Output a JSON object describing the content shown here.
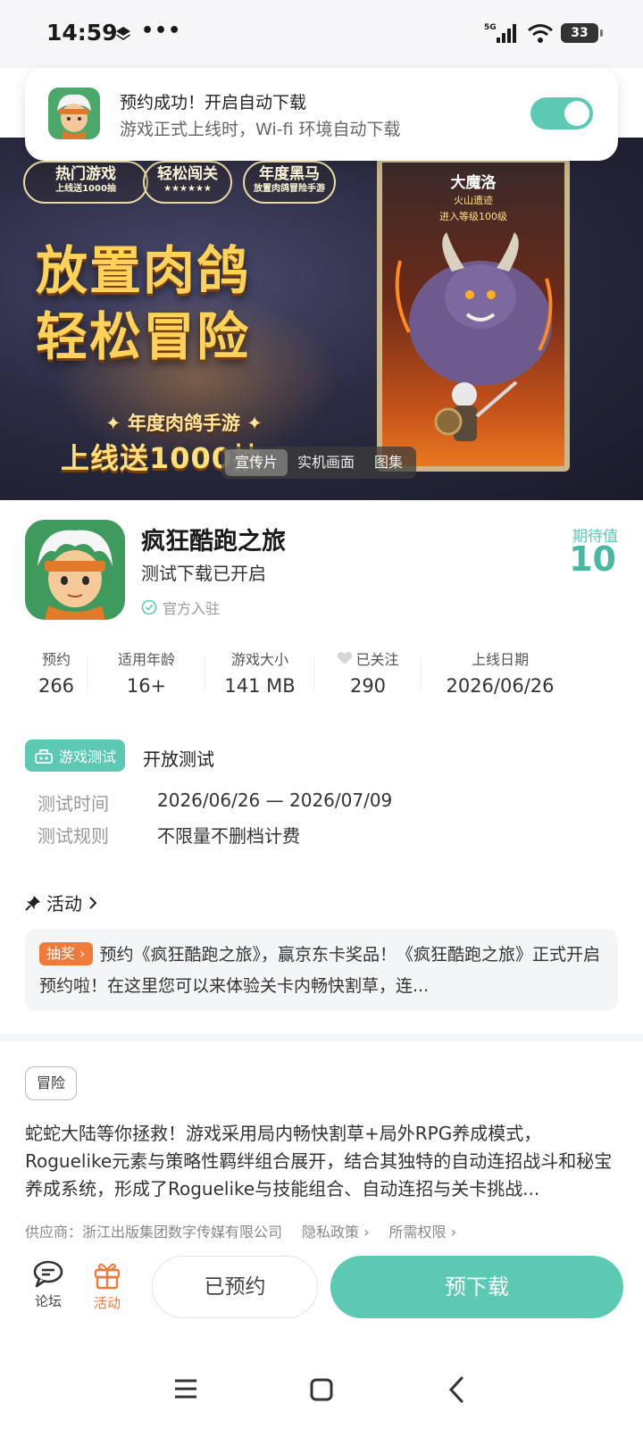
{
  "status_bar": {
    "time": "14:59",
    "dots": "•••",
    "network": "5G",
    "battery": "33"
  },
  "toast": {
    "title": "预约成功！开启自动下载",
    "subtitle": "游戏正式上线时，Wi-fi 环境自动下载",
    "auto_download_enabled": true
  },
  "banner": {
    "badges": [
      {
        "main": "热门游戏",
        "sub": "上线送1000抽"
      },
      {
        "main": "轻松闯关",
        "sub": "★★★★★★"
      },
      {
        "main": "年度黑马",
        "sub": "放置肉鸽冒险手游"
      }
    ],
    "headline_line1": "放置肉鸽",
    "headline_line2": "轻松冒险",
    "subline": "✦ 年度肉鸽手游 ✦",
    "promo": "上线送1000抽",
    "card_title": "大魔洛",
    "card_line1": "火山遗迹",
    "card_line2": "进入等级100级",
    "media_tabs": [
      "宣传片",
      "实机画面",
      "图集"
    ],
    "active_tab": 0
  },
  "app": {
    "name": "疯狂酷跑之旅",
    "status": "测试下载已开启",
    "verified": "官方入驻",
    "expect_label": "期待值",
    "expect_value": "10"
  },
  "stats": [
    {
      "label": "预约",
      "value": "266"
    },
    {
      "label": "适用年龄",
      "value": "16+"
    },
    {
      "label": "游戏大小",
      "value": "141 MB"
    },
    {
      "label": "已关注",
      "value": "290"
    },
    {
      "label": "上线日期",
      "value": "2026/06/26"
    }
  ],
  "test": {
    "badge": "游戏测试",
    "type": "开放测试",
    "time_label": "测试时间",
    "time_value": "2026/06/26 — 2026/07/09",
    "rule_label": "测试规则",
    "rule_value": "不限量不删档计费"
  },
  "activity": {
    "heading": "活动",
    "tag": "抽奖",
    "text": "预约《疯狂酷跑之旅》，赢京东卡奖品！《疯狂酷跑之旅》正式开启预约啦！在这里您可以来体验关卡内畅快割草，连..."
  },
  "description": {
    "genre": "冒险",
    "text": "蛇蛇大陆等你拯救！游戏采用局内畅快割草+局外RPG养成模式，Roguelike元素与策略性羁绊组合展开，结合其独特的自动连招战斗和秘宝养成系统，形成了Roguelike与技能组合、自动连招与关卡挑战...",
    "supplier": "供应商：浙江出版集团数字传媒有限公司",
    "privacy": "隐私政策",
    "permissions": "所需权限"
  },
  "bottom_bar": {
    "forum": "论坛",
    "activity": "活动",
    "reserved": "已预约",
    "predownload": "预下载"
  },
  "colors": {
    "accent": "#5ccab3",
    "orange": "#f07a3a"
  }
}
